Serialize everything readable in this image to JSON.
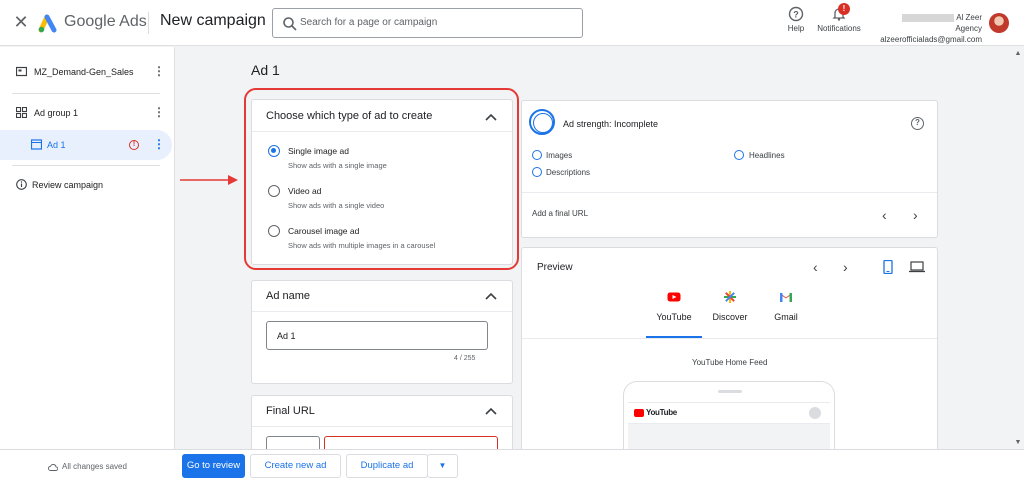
{
  "app": {
    "brand": "Google Ads",
    "page_title": "New campaign",
    "search_placeholder": "Search for a page or campaign"
  },
  "header": {
    "help_label": "Help",
    "notifications_label": "Notifications",
    "notifications_badge": "!",
    "account_name": "Al Zeer Agency",
    "account_email": "alzeerofficialads@gmail.com"
  },
  "sidebar": {
    "campaign": "MZ_Demand-Gen_Sales",
    "ad_group": "Ad group 1",
    "ad": "Ad 1",
    "review": "Review campaign"
  },
  "main": {
    "heading": "Ad 1",
    "ad_type": {
      "title": "Choose which type of ad to create",
      "options": [
        {
          "label": "Single image ad",
          "desc": "Show ads with a single image",
          "selected": true
        },
        {
          "label": "Video ad",
          "desc": "Show ads with a single video",
          "selected": false
        },
        {
          "label": "Carousel image ad",
          "desc": "Show ads with multiple images in a carousel",
          "selected": false
        }
      ]
    },
    "ad_name": {
      "title": "Ad name",
      "value": "Ad 1",
      "counter": "4 / 255"
    },
    "final_url": {
      "title": "Final URL"
    }
  },
  "strength": {
    "title": "Ad strength: Incomplete",
    "items": [
      "Images",
      "Headlines",
      "Descriptions"
    ],
    "final_url_prompt": "Add a final URL"
  },
  "preview": {
    "title": "Preview",
    "tabs": [
      "YouTube",
      "Discover",
      "Gmail"
    ],
    "active_tab": "YouTube",
    "feed_label": "YouTube Home Feed",
    "yt_wordmark": "YouTube"
  },
  "footer": {
    "saved": "All changes saved",
    "go_to_review": "Go to review",
    "create_new_ad": "Create new ad",
    "duplicate_ad": "Duplicate ad"
  },
  "colors": {
    "accent": "#1a73e8",
    "error": "#d93025",
    "highlight": "#e53935"
  }
}
